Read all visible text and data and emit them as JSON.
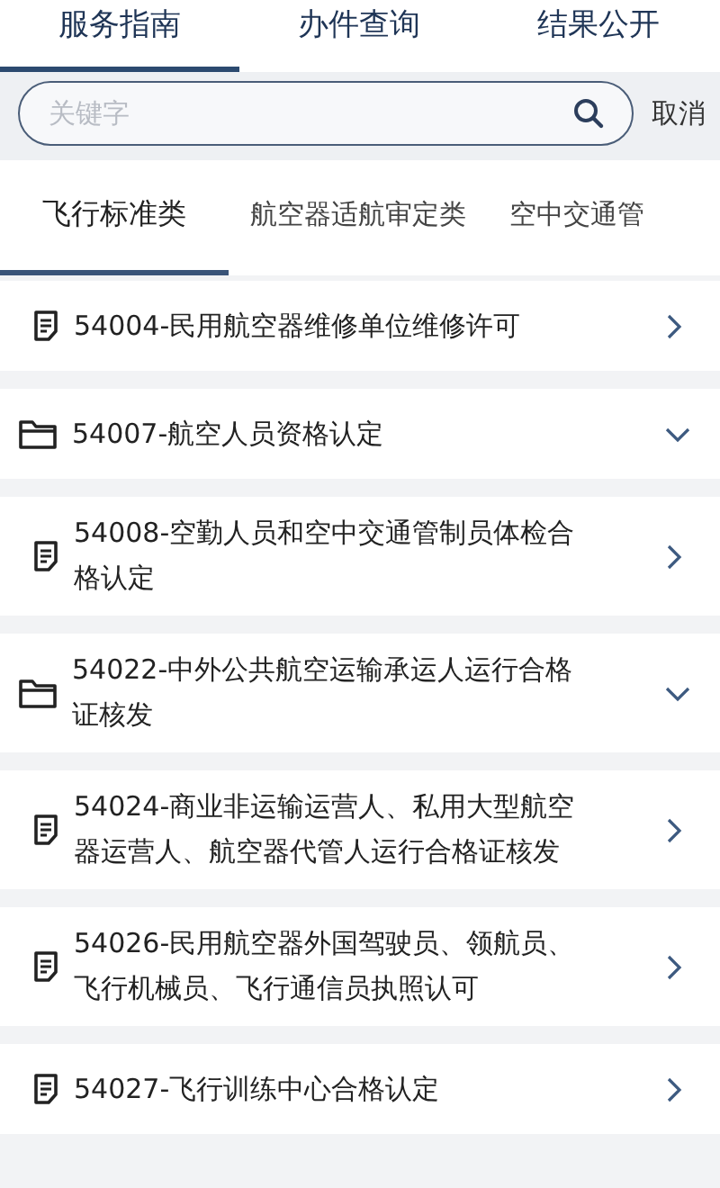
{
  "tabs": [
    {
      "label": "服务指南",
      "selected": true
    },
    {
      "label": "办件查询",
      "selected": false
    },
    {
      "label": "结果公开",
      "selected": false
    }
  ],
  "search": {
    "placeholder": "关键字",
    "cancel": "取消"
  },
  "categories": [
    {
      "label": "飞行标准类",
      "selected": true
    },
    {
      "label": "航空器适航审定类",
      "selected": false
    },
    {
      "label": "空中交通管",
      "selected": false
    }
  ],
  "items": [
    {
      "kind": "document",
      "title": "54004-民用航空器维修单位维修许可"
    },
    {
      "kind": "folder",
      "title": "54007-航空人员资格认定"
    },
    {
      "kind": "document",
      "title": "54008-空勤人员和空中交通管制员体检合格认定"
    },
    {
      "kind": "folder",
      "title": "54022-中外公共航空运输承运人运行合格证核发"
    },
    {
      "kind": "document",
      "title": "54024-商业非运输运营人、私用大型航空器运营人、航空器代管人运行合格证核发"
    },
    {
      "kind": "document",
      "title": "54026-民用航空器外国驾驶员、领航员、飞行机械员、飞行通信员执照认可"
    },
    {
      "kind": "document",
      "title": "54027-飞行训练中心合格认定"
    }
  ]
}
